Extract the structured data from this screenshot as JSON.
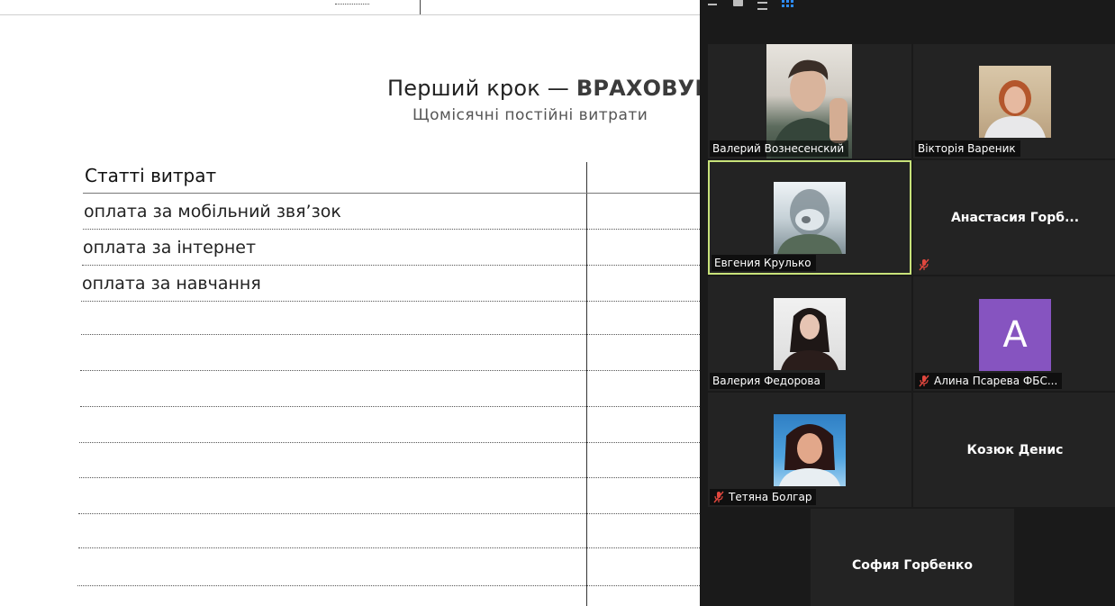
{
  "document": {
    "top_marker": ".....",
    "title_main": "Перший крок —",
    "title_accent": "ВРАХОВУЙ",
    "subtitle": "Щомісячні постійні витрати",
    "table_header": "Статті витрат",
    "rows": [
      "оплата за мобільний звя’зок",
      "оплата за інтернет",
      "оплата за навчання"
    ]
  },
  "gallery": {
    "participants": [
      {
        "name": "Валерий Вознесенский",
        "muted": false,
        "has_video": true,
        "active": false
      },
      {
        "name": "Вікторія Вареник",
        "muted": false,
        "has_video": true,
        "active": false
      },
      {
        "name": "Евгения Крулько",
        "muted": false,
        "has_video": true,
        "active": true
      },
      {
        "name": "Анастасия  Горб...",
        "muted": true,
        "has_video": false,
        "active": false
      },
      {
        "name": "Валерия Федорова",
        "muted": false,
        "has_video": true,
        "active": false
      },
      {
        "name": "Алина Псарева ФБС...",
        "muted": true,
        "has_video": false,
        "avatar_letter": "A",
        "avatar_color": "#8654c0",
        "active": false
      },
      {
        "name": "Тетяна Болгар",
        "muted": true,
        "has_video": true,
        "active": false
      },
      {
        "name": "Козюк Денис",
        "muted": false,
        "has_video": false,
        "active": false
      },
      {
        "name": "София Горбенко",
        "muted": false,
        "has_video": false,
        "active": false
      }
    ],
    "colors": {
      "active_border": "#c8e27a",
      "tile_bg": "#232323",
      "muted_icon": "#e0473e",
      "grid_icon": "#2d8cff"
    }
  }
}
